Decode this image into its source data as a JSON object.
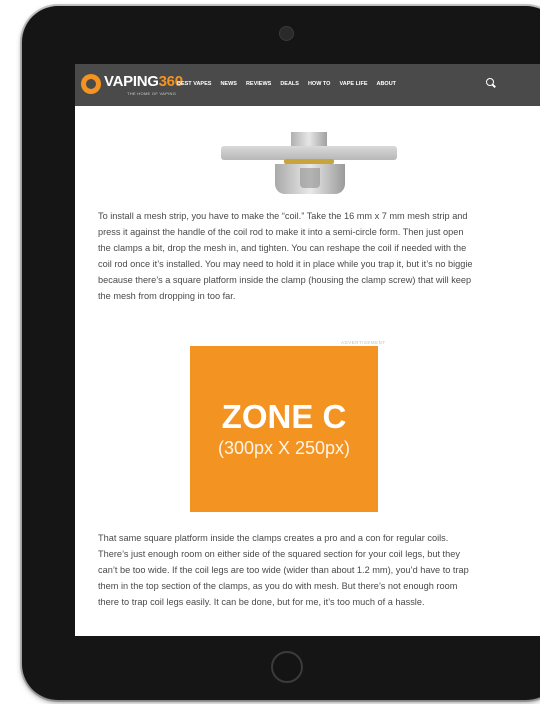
{
  "site": {
    "logo_text": "VAPING",
    "logo_number": "360",
    "logo_tagline": "THE HOME OF VAPING"
  },
  "nav": {
    "items": [
      "BEST VAPES",
      "NEWS",
      "REVIEWS",
      "DEALS",
      "HOW TO",
      "VAPE LIFE",
      "ABOUT"
    ]
  },
  "article": {
    "paragraph1": "To install a mesh strip, you have to make the “coil.” Take the 16 mm x 7 mm mesh strip and press it against the handle of the coil rod to make it into a semi-circle form. Then just open the clamps a bit, drop the mesh in, and tighten. You can reshape the coil if needed with the coil rod once it’s installed. You may need to hold it in place while you trap it, but it’s no biggie because there’s a square platform inside the clamp (housing the clamp screw) that will keep the mesh from dropping in too far.",
    "paragraph2": "That same square platform inside the clamps creates a pro and a con for regular coils. There’s just enough room on either side of the squared section for your coil legs, but they can’t be too wide. If the coil legs are too wide (wider than about 1.2 mm), you’d have to trap them in the top section of the clamps, as you do with mesh. But there’s not enough room there to trap coil legs easily. It can be done, but for me, it’s too much of a hassle."
  },
  "ad": {
    "label": "ADVERTISEMENT",
    "title": "ZONE C",
    "size": "(300px X 250px)",
    "color": "#f39422"
  }
}
